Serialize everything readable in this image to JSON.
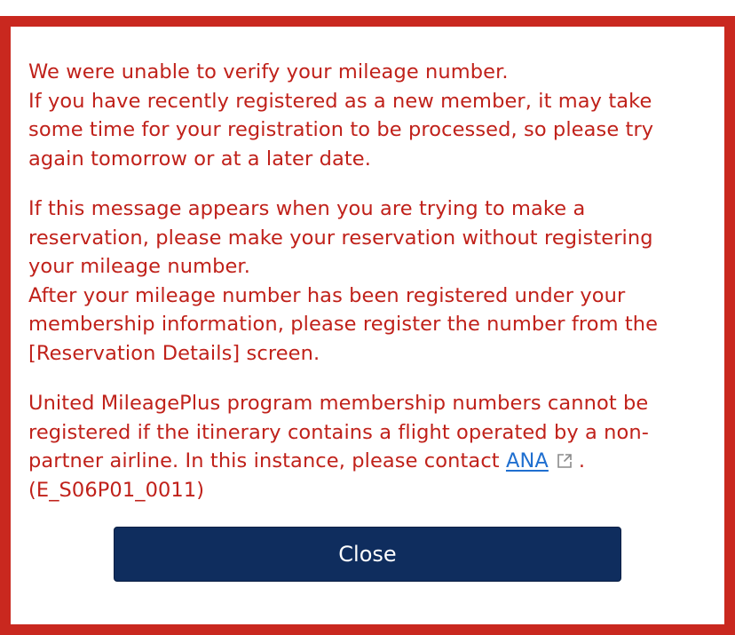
{
  "dialog": {
    "paragraph1": [
      "We were unable to verify your mileage number.",
      "If you have recently registered as a new member, it may take",
      "some time for your registration to be processed, so please try",
      "again tomorrow or at a later date."
    ],
    "paragraph2": [
      "If this message appears when you are trying to make a",
      "reservation, please make your reservation without registering",
      "your mileage number.",
      "After your mileage number has been registered under your",
      "membership information, please register the number from the",
      "[Reservation Details] screen."
    ],
    "paragraph3": [
      "United MileagePlus program membership numbers cannot be",
      "registered if the itinerary contains a flight operated by a non-",
      "partner airline. In this instance, please contact "
    ],
    "contact_link": "ANA",
    "contact_suffix": ".",
    "error_code": "(E_S06P01_0011)",
    "close_label": "Close",
    "external_link_icon": "external-link-icon"
  },
  "colors": {
    "frame_red": "#c9281f",
    "message_red": "#c0211a",
    "link_blue": "#1f6fd0",
    "button_navy": "#0f2d5e"
  }
}
